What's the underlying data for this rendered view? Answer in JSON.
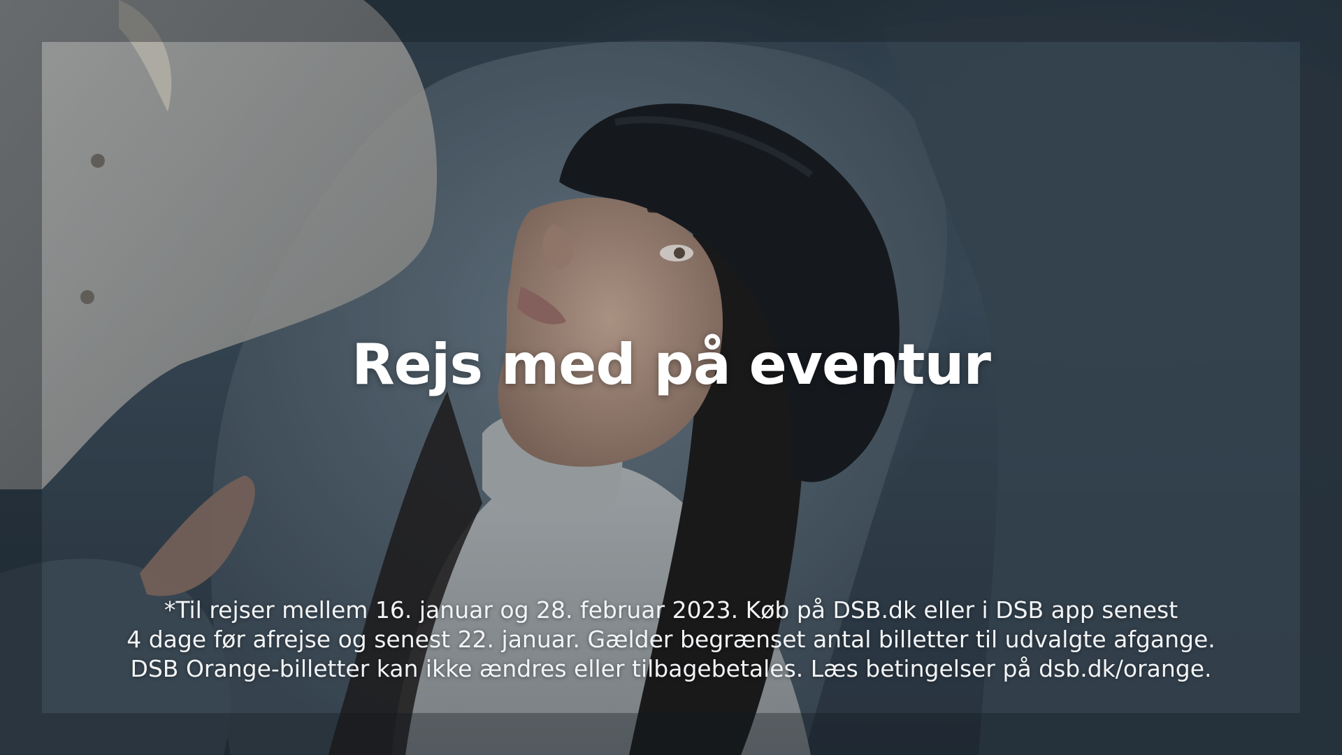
{
  "headline": "Rejs med på eventur",
  "disclaimer": {
    "lines": [
      "*Til rejser mellem 16. januar og 28. februar 2023. Køb på DSB.dk eller i DSB app senest",
      "4 dage før afrejse og senest 22. januar. Gælder begrænset antal billetter til udvalgte afgange.",
      "DSB Orange-billetter kan ikke ændres eller tilbagebetales. Læs betingelser på dsb.dk/orange."
    ]
  },
  "palette": {
    "background": "#2f3e4a",
    "text": "#ffffff"
  }
}
